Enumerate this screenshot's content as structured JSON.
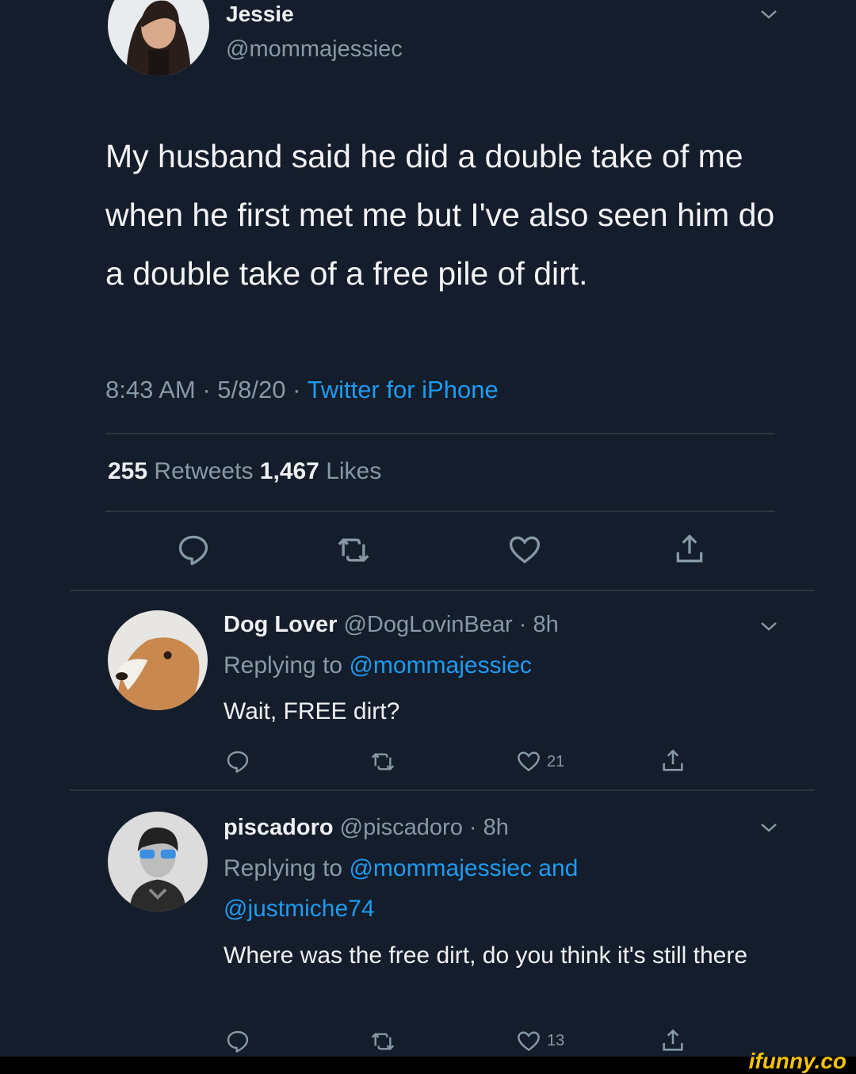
{
  "main_tweet": {
    "name": "Jessie",
    "handle": "@mommajessiec",
    "text": "My husband said he did a double take of me when he first met me but I've also seen him do a double take of a free pile of dirt.",
    "time_date": "8:43 AM · 5/8/20 · ",
    "source": "Twitter for iPhone",
    "retweets_count": "255",
    "retweets_label": " Retweets  ",
    "likes_count": "1,467",
    "likes_label": " Likes"
  },
  "replies": [
    {
      "name": "Dog Lover",
      "handle_time": " @DogLovinBear · 8h",
      "replying_prefix": "Replying to ",
      "replying_to": "@mommajessiec",
      "text": "Wait, FREE dirt?",
      "like_count": "21"
    },
    {
      "name": "piscadoro",
      "handle_time": " @piscadoro · 8h",
      "replying_prefix": "Replying to ",
      "replying_to": "@mommajessiec and",
      "replying_to_line2": "@justmiche74",
      "text": "Where was the free dirt, do you think it's still there",
      "like_count": "13"
    }
  ],
  "watermark": "ifunny.co",
  "colors": {
    "background": "#141d2b",
    "link": "#1d9bf0",
    "muted": "#8899a6"
  },
  "icons": [
    "reply-icon",
    "retweet-icon",
    "like-icon",
    "share-icon",
    "chevron-down-icon"
  ]
}
